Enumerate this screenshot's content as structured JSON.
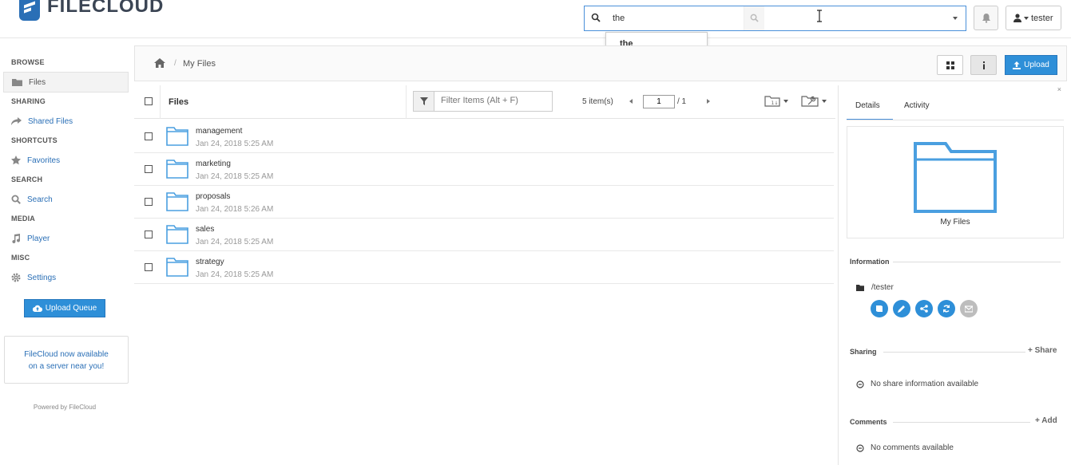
{
  "brand": {
    "name": "FILECLOUD"
  },
  "search": {
    "value": "the",
    "suggestion": "the"
  },
  "user": {
    "name": "tester"
  },
  "sidebar": {
    "sections": [
      {
        "label": "BROWSE"
      },
      {
        "label": "SHARING"
      },
      {
        "label": "SHORTCUTS"
      },
      {
        "label": "SEARCH"
      },
      {
        "label": "MEDIA"
      },
      {
        "label": "MISC"
      }
    ],
    "items": [
      {
        "label": "Files"
      },
      {
        "label": "Shared Files"
      },
      {
        "label": "Favorites"
      },
      {
        "label": "Search"
      },
      {
        "label": "Player"
      },
      {
        "label": "Settings"
      }
    ],
    "upload_queue_label": "Upload Queue",
    "promo_line1": "FileCloud now available",
    "promo_line2": "on a server near you!",
    "powered": "Powered by FileCloud"
  },
  "breadcrumb": {
    "sep": "/",
    "current": "My Files"
  },
  "toolbar": {
    "upload_label": "Upload"
  },
  "list": {
    "title": "Files",
    "filter_placeholder": "Filter Items (Alt + F)",
    "count": "5 item(s)",
    "page": "1",
    "page_total": "/ 1",
    "rows": [
      {
        "name": "management",
        "date": "Jan 24, 2018 5:25 AM"
      },
      {
        "name": "marketing",
        "date": "Jan 24, 2018 5:25 AM"
      },
      {
        "name": "proposals",
        "date": "Jan 24, 2018 5:26 AM"
      },
      {
        "name": "sales",
        "date": "Jan 24, 2018 5:25 AM"
      },
      {
        "name": "strategy",
        "date": "Jan 24, 2018 5:25 AM"
      }
    ]
  },
  "details": {
    "close": "×",
    "tabs": [
      {
        "label": "Details"
      },
      {
        "label": "Activity"
      }
    ],
    "folder_label": "My Files",
    "information_h": "Information",
    "path": "/tester",
    "sharing_h": "Sharing",
    "share_add": "+ Share",
    "no_share": "No share information available",
    "comments_h": "Comments",
    "comment_add": "+ Add",
    "no_comments": "No comments available"
  },
  "colors": {
    "accent": "#2e8fd8",
    "folder": "#4a9fe0"
  }
}
